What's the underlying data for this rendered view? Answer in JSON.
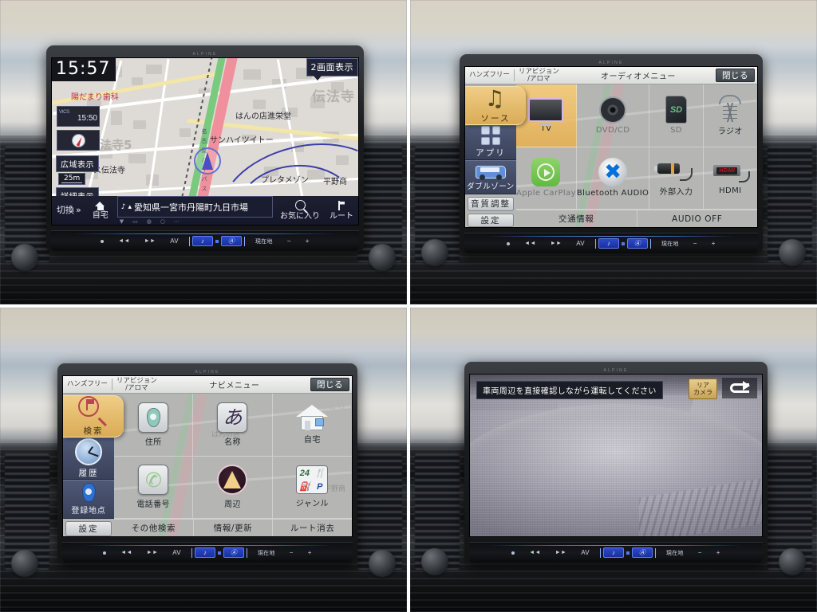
{
  "panels": {
    "nav_map": {
      "brand": "ALPINE",
      "clock": "15:57",
      "vics_label": "VICS",
      "vics_time": "15:50",
      "split_screen_button": "2画面表示",
      "wide_view_button": "広域表示",
      "scale": "25m",
      "detail_view_button": "詳細表示",
      "switch_button": "切換",
      "home_button": "自宅",
      "address": "愛知県一宮市丹陽町九日市場",
      "favorite_button": "お気に入り",
      "route_button": "ルート",
      "map_labels": [
        "陽だまり歯科",
        "伝法寺",
        "はんの店進栄堂",
        "サンハイツイトー",
        "プレタメゾン",
        "平野商",
        "法寺5",
        "ス伝法寺",
        "名　古　屋　パ　イ　パ　ス"
      ]
    },
    "audio_menu": {
      "brand": "ALPINE",
      "handsfree_button": "ハンズフリー",
      "rearvision_button": "リアビジョン\n/アロマ",
      "title": "オーディオメニュー",
      "close_button": "閉じる",
      "side_tabs": [
        {
          "label": "ソース",
          "icon": "music-note-icon",
          "active": true
        },
        {
          "label": "アプリ",
          "icon": "apps-grid-icon",
          "active": false
        },
        {
          "label": "ダブルゾーン",
          "icon": "car-dual-zone-icon",
          "active": false
        }
      ],
      "side_buttons": [
        {
          "label": "音質調整"
        },
        {
          "label": "設定"
        }
      ],
      "sources": [
        {
          "label": "TV",
          "icon": "tv-icon",
          "selected": true,
          "dim": false
        },
        {
          "label": "DVD/CD",
          "icon": "disc-icon",
          "selected": false,
          "dim": true
        },
        {
          "label": "SD",
          "icon": "sd-card-icon",
          "selected": false,
          "dim": true
        },
        {
          "label": "ラジオ",
          "icon": "radio-tower-icon",
          "selected": false,
          "dim": false
        },
        {
          "label": "Apple CarPlay",
          "icon": "carplay-icon",
          "selected": false,
          "dim": true
        },
        {
          "label": "Bluetooth AUDIO",
          "icon": "bluetooth-icon",
          "selected": false,
          "dim": false
        },
        {
          "label": "外部入力",
          "icon": "aux-plug-icon",
          "selected": false,
          "dim": false
        },
        {
          "label": "HDMI",
          "icon": "hdmi-stick-icon",
          "selected": false,
          "dim": false
        }
      ],
      "footer": [
        {
          "label": "交通情報"
        },
        {
          "label": "AUDIO OFF"
        }
      ]
    },
    "navi_menu": {
      "brand": "ALPINE",
      "handsfree_button": "ハンズフリー",
      "rearvision_button": "リアビジョン\n/アロマ",
      "title": "ナビメニュー",
      "close_button": "閉じる",
      "side_tabs": [
        {
          "label": "検索",
          "icon": "search-flag-icon",
          "active": true
        },
        {
          "label": "履歴",
          "icon": "clock-history-icon",
          "active": false
        },
        {
          "label": "登録地点",
          "icon": "map-pin-icon",
          "active": false
        }
      ],
      "side_buttons": [
        {
          "label": "設定"
        }
      ],
      "items": [
        {
          "label": "住所",
          "icon": "location-pin-icon"
        },
        {
          "label": "名称",
          "icon": "kana-a-icon"
        },
        {
          "label": "自宅",
          "icon": "house-icon"
        },
        {
          "label": "電話番号",
          "icon": "phone-icon"
        },
        {
          "label": "周辺",
          "icon": "compass-arrow-icon"
        },
        {
          "label": "ジャンル",
          "icon": "genre-grid-icon"
        }
      ],
      "footer": [
        {
          "label": "その他検索"
        },
        {
          "label": "情報/更新"
        },
        {
          "label": "ルート消去"
        }
      ],
      "genre_cells": [
        "24",
        "🍴",
        "⛽",
        "P"
      ]
    },
    "rear_camera": {
      "brand": "ALPINE",
      "warning": "車両周辺を直接確認しながら運転してください",
      "camera_tag": "リア\nカメラ",
      "back_button_icon": "back-arrow-icon"
    }
  },
  "hardware_keys": {
    "power_label": "●",
    "prev_label": "◄◄",
    "next_label": "►►",
    "av_label": "AV",
    "music_label": "♪",
    "current_location_label": "現在地",
    "minus_label": "−",
    "plus_label": "+"
  }
}
